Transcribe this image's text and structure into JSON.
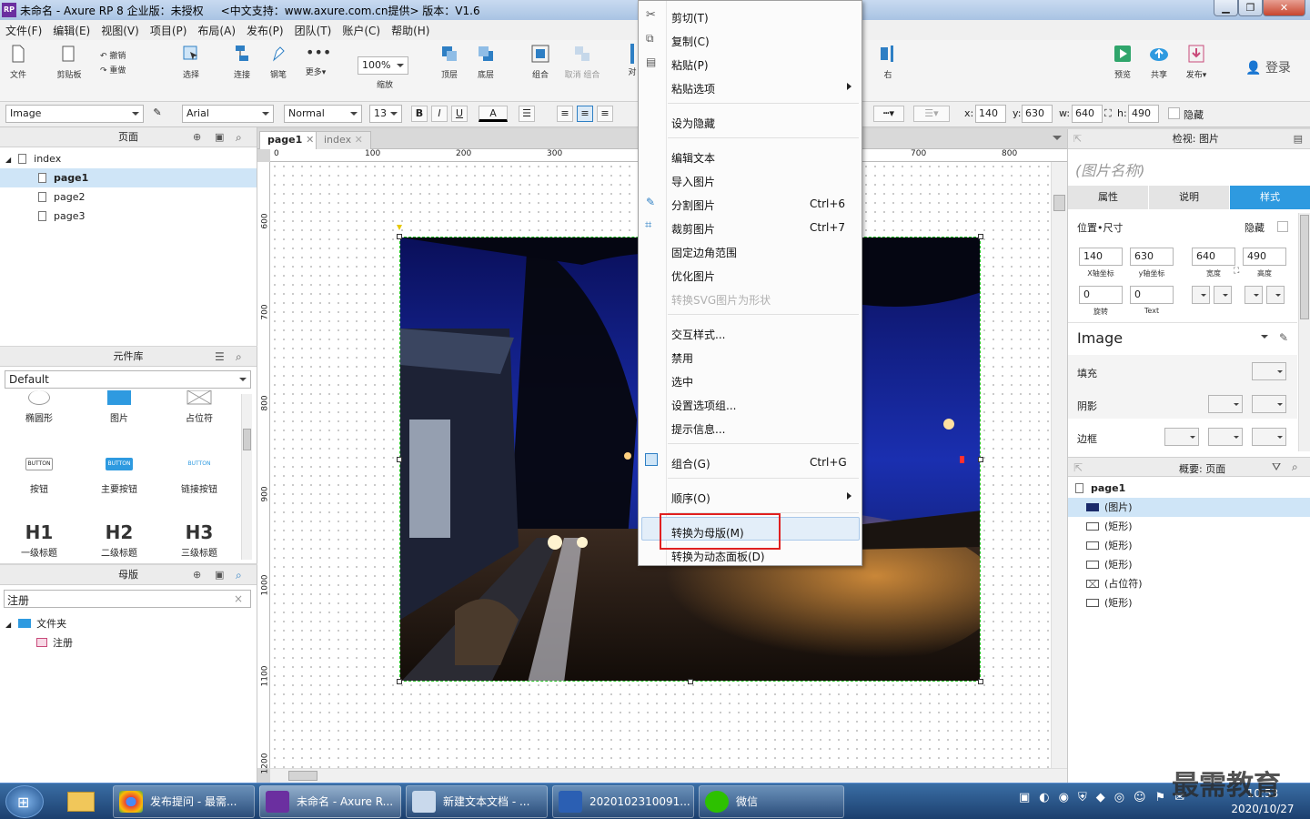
{
  "window": {
    "title": "未命名 - Axure RP 8 企业版：未授权     <中文支持：www.axure.com.cn提供> 版本：V1.6",
    "app_icon": "RP",
    "controls": [
      "minimize",
      "maximize",
      "close"
    ]
  },
  "menu": [
    "文件(F)",
    "编辑(E)",
    "视图(V)",
    "项目(P)",
    "布局(A)",
    "发布(P)",
    "团队(T)",
    "账户(C)",
    "帮助(H)"
  ],
  "toolbar": {
    "file": "文件",
    "clipboard": "剪贴板",
    "undo": "撤销",
    "redo": "重做",
    "select": "选择",
    "connect": "连接",
    "pen": "钢笔",
    "more": "更多▾",
    "zoom": "100%",
    "zoom_label": "缩放",
    "top": "顶层",
    "bottom": "底层",
    "group": "组合",
    "ungroup": "取消 组合",
    "align": "对",
    "right": "右",
    "preview": "预览",
    "share": "共享",
    "publish": "发布▾",
    "login": "登录"
  },
  "format": {
    "style": "Image",
    "font": "Arial",
    "weight": "Normal",
    "size": "13",
    "bold": "B",
    "italic": "I",
    "underline": "U",
    "text_color": "A",
    "x_label": "x:",
    "x": "140",
    "y_label": "y:",
    "y": "630",
    "w_label": "w:",
    "w": "640",
    "h_label": "h:",
    "h": "490",
    "hide": "隐藏"
  },
  "pages_panel": {
    "title": "页面",
    "root": "index",
    "pages": [
      "page1",
      "page2",
      "page3"
    ],
    "selected": "page1"
  },
  "library_panel": {
    "title": "元件库",
    "library": "Default",
    "widgets": [
      {
        "label": "椭圆形",
        "icon": "ellipse-icon"
      },
      {
        "label": "图片",
        "icon": "image-icon"
      },
      {
        "label": "占位符",
        "icon": "placeholder-icon"
      },
      {
        "label": "按钮",
        "icon": "button-icon",
        "text": "BUTTON"
      },
      {
        "label": "主要按钮",
        "icon": "primary-button-icon",
        "text": "BUTTON"
      },
      {
        "label": "链接按钮",
        "icon": "link-button-icon",
        "text": "BUTTON"
      },
      {
        "label": "一级标题",
        "icon": "h1-icon",
        "text": "H1"
      },
      {
        "label": "二级标题",
        "icon": "h2-icon",
        "text": "H2"
      },
      {
        "label": "三级标题",
        "icon": "h3-icon",
        "text": "H3"
      }
    ]
  },
  "masters_panel": {
    "title": "母版",
    "search": "注册",
    "folder": "文件夹",
    "item": "注册"
  },
  "canvas": {
    "tabs": [
      "page1",
      "index"
    ],
    "active_tab": "page1",
    "ruler_h": [
      "0",
      "100",
      "200",
      "300",
      "700",
      "800"
    ],
    "ruler_v": [
      "600",
      "700",
      "800",
      "900",
      "1000",
      "1100",
      "1200"
    ]
  },
  "context_menu": {
    "items": [
      {
        "label": "剪切(T)",
        "icon": "cut-icon"
      },
      {
        "label": "复制(C)",
        "icon": "copy-icon"
      },
      {
        "label": "粘贴(P)",
        "icon": "paste-icon"
      },
      {
        "label": "粘贴选项",
        "submenu": true
      },
      {
        "label": "设为隐藏"
      },
      {
        "label": "编辑文本"
      },
      {
        "label": "导入图片"
      },
      {
        "label": "分割图片",
        "shortcut": "Ctrl+6",
        "icon": "slice-icon"
      },
      {
        "label": "裁剪图片",
        "shortcut": "Ctrl+7",
        "icon": "crop-icon"
      },
      {
        "label": "固定边角范围"
      },
      {
        "label": "优化图片"
      },
      {
        "label": "转换SVG图片为形状",
        "disabled": true
      },
      {
        "label": "交互样式..."
      },
      {
        "label": "禁用"
      },
      {
        "label": "选中"
      },
      {
        "label": "设置选项组..."
      },
      {
        "label": "提示信息..."
      },
      {
        "label": "组合(G)",
        "shortcut": "Ctrl+G",
        "icon": "group-icon"
      },
      {
        "label": "顺序(O)",
        "submenu": true
      },
      {
        "label": "转换为母版(M)",
        "highlighted": true
      },
      {
        "label": "转换为动态面板(D)"
      }
    ]
  },
  "inspector": {
    "title": "检视: 图片",
    "name_placeholder": "(图片名称)",
    "tabs": [
      "属性",
      "说明",
      "样式"
    ],
    "active_tab": "样式",
    "section": "位置•尺寸",
    "hide": "隐藏",
    "x": "140",
    "y": "630",
    "w": "640",
    "h": "490",
    "x_cap": "X轴坐标",
    "y_cap": "y轴坐标",
    "w_cap": "宽度",
    "h_cap": "高度",
    "rotate": "0",
    "rotate_cap": "旋转",
    "text_rotate": "0",
    "text_cap": "Text",
    "style_name": "Image",
    "fill": "填充",
    "shadow": "阴影",
    "border": "边框"
  },
  "outline": {
    "title": "概要: 页面",
    "page": "page1",
    "items": [
      "(图片)",
      "(矩形)",
      "(矩形)",
      "(矩形)",
      "(占位符)",
      "(矩形)"
    ]
  },
  "taskbar": {
    "tasks": [
      "发布提问 - 最需...",
      "未命名 - Axure R...",
      "新建文本文档 - ...",
      "2020102310091...",
      "微信"
    ],
    "time": "10:53",
    "date": "2020/10/27",
    "watermark": "最需教育"
  },
  "colors": {
    "accent_blue": "#2e9ae0",
    "highlight_red": "#e02020",
    "selection": "#cfe5f7"
  }
}
